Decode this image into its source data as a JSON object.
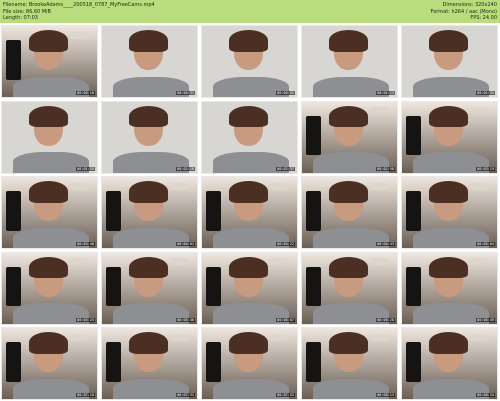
{
  "header": {
    "filename_label": "Filename: BrookeAdams____200518_0787_MyFreeCams.mp4",
    "filesize_label": "File size: 86.60 MiB",
    "length_label": "Length: 07:03",
    "dimensions_label": "Dimensions: 320x240",
    "format_label": "Format: h264 / aac (Mono)",
    "fps_label": "FPS: 24.00"
  },
  "thumbnails": [
    {
      "ts": "00:00:10",
      "scene": "bedroom"
    },
    {
      "ts": "00:00:31",
      "scene": "bed"
    },
    {
      "ts": "00:00:52",
      "scene": "bed"
    },
    {
      "ts": "00:01:13",
      "scene": "bed"
    },
    {
      "ts": "00:01:34",
      "scene": "bed"
    },
    {
      "ts": "00:01:55",
      "scene": "bed"
    },
    {
      "ts": "00:02:16",
      "scene": "bed"
    },
    {
      "ts": "00:02:37",
      "scene": "bed"
    },
    {
      "ts": "00:02:58",
      "scene": "bedroom"
    },
    {
      "ts": "00:03:19",
      "scene": "bedroom"
    },
    {
      "ts": "00:03:40",
      "scene": "bedroom"
    },
    {
      "ts": "00:04:01",
      "scene": "bedroom"
    },
    {
      "ts": "00:04:22",
      "scene": "bedroom"
    },
    {
      "ts": "00:04:43",
      "scene": "bedroom"
    },
    {
      "ts": "00:05:04",
      "scene": "bedroom"
    },
    {
      "ts": "00:05:25",
      "scene": "bedroom"
    },
    {
      "ts": "00:05:46",
      "scene": "bedroom"
    },
    {
      "ts": "00:06:07",
      "scene": "bedroom"
    },
    {
      "ts": "00:06:28",
      "scene": "bedroom"
    },
    {
      "ts": "00:06:49",
      "scene": "bedroom"
    },
    {
      "ts": "00:07:10",
      "scene": "bedroom"
    },
    {
      "ts": "00:07:31",
      "scene": "bedroom"
    },
    {
      "ts": "00:07:52",
      "scene": "bedroom"
    },
    {
      "ts": "00:08:13",
      "scene": "bedroom"
    },
    {
      "ts": "00:08:34",
      "scene": "bedroom"
    }
  ],
  "colors": {
    "header_bg": "#b9dc7c",
    "bedroom_bg": "#6b5f55",
    "bed_bg": "#d7d6d3",
    "wall_bg": "#efe7df"
  }
}
